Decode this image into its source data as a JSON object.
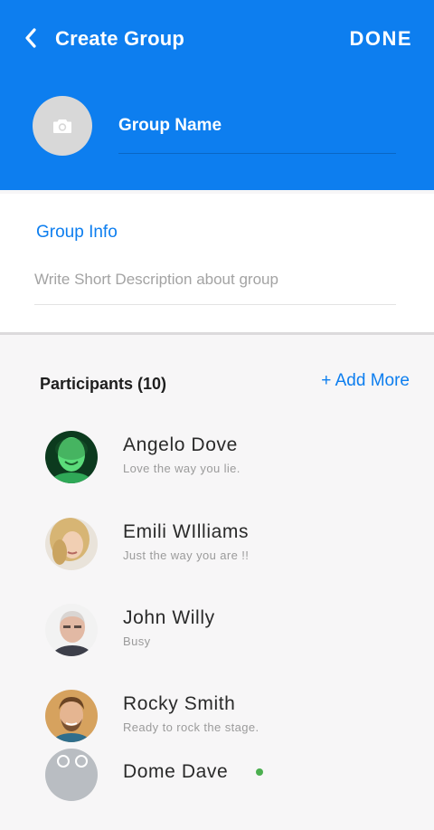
{
  "header": {
    "back_icon": "chevron-left-icon",
    "title": "Create Group",
    "done_label": "DONE",
    "camera_icon": "camera-icon",
    "group_name_placeholder": "Group Name",
    "colors": {
      "primary": "#0d7eef"
    }
  },
  "info": {
    "label": "Group Info",
    "description_placeholder": "Write Short Description about group"
  },
  "participants": {
    "title": "Participants (10)",
    "add_more_label": "+ Add More",
    "items": [
      {
        "name": "Angelo Dove",
        "status": "Love the way you  lie."
      },
      {
        "name": "Emili WIlliams",
        "status": "Just the way you are !!"
      },
      {
        "name": "John Willy",
        "status": "Busy"
      },
      {
        "name": "Rocky Smith",
        "status": "Ready to rock the stage."
      },
      {
        "name": "Dome Dave"
      }
    ]
  }
}
